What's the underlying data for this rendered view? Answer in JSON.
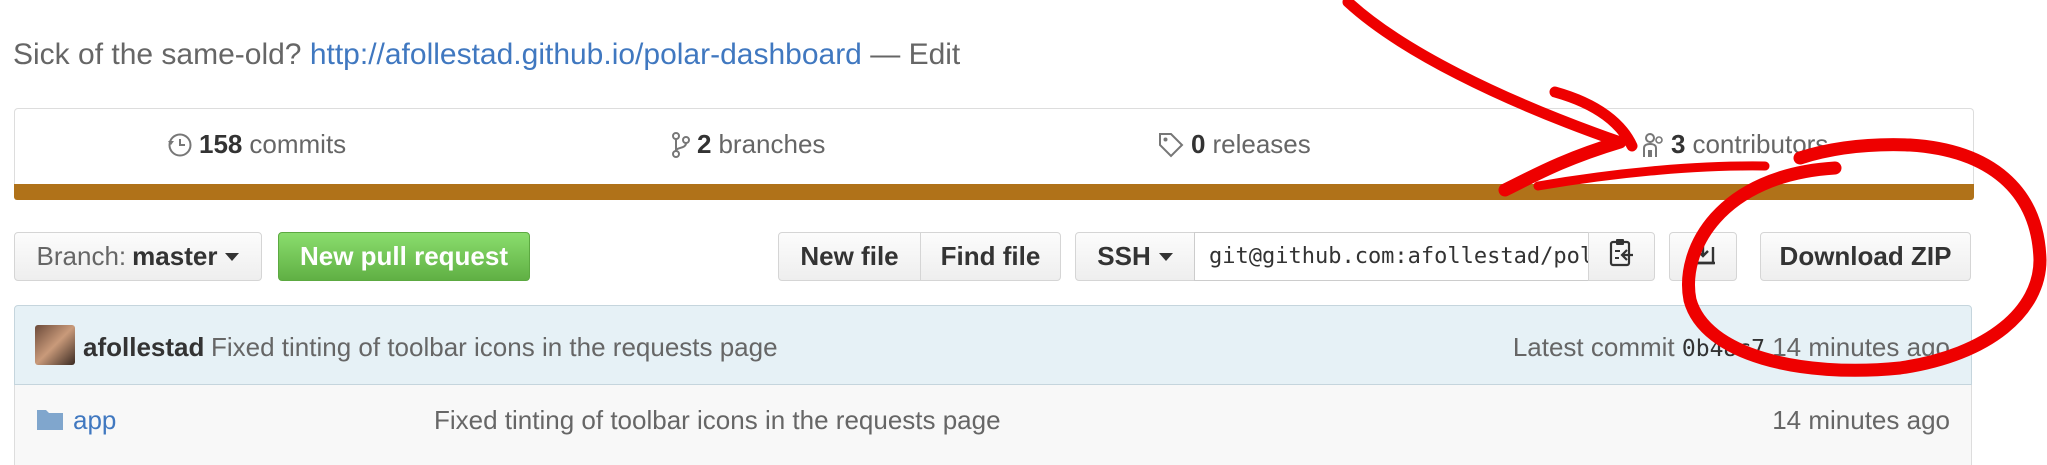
{
  "description": {
    "prefix": "Sick of the same-old?",
    "url": "http://afollestad.github.io/polar-dashboard",
    "separator": "—",
    "edit": "Edit"
  },
  "summary": {
    "commits": {
      "count": "158",
      "label": "commits",
      "icon": "history-icon"
    },
    "branches": {
      "count": "2",
      "label": "branches",
      "icon": "branch-icon"
    },
    "releases": {
      "count": "0",
      "label": "releases",
      "icon": "tag-icon"
    },
    "contributors": {
      "count": "3",
      "label": "contributors",
      "icon": "organization-icon"
    }
  },
  "language_bar": {
    "color": "#b07219",
    "percent": 100
  },
  "toolbar": {
    "branch_prefix": "Branch:",
    "branch_name": "master",
    "new_pull_request": "New pull request",
    "new_file": "New file",
    "find_file": "Find file",
    "protocol": "SSH",
    "clone_url": "git@github.com:afollestad/polar-dashboard.git",
    "clipboard_icon": "clippy-icon",
    "desktop_icon": "desktop-download-icon",
    "download_zip": "Download ZIP"
  },
  "latest_commit": {
    "author": "afollestad",
    "message": "Fixed tinting of toolbar icons in the requests page",
    "label": "Latest commit",
    "sha": "0b48c7",
    "age": "14 minutes ago"
  },
  "files": [
    {
      "name": "app",
      "type": "folder",
      "message": "Fixed tinting of toolbar icons in the requests page",
      "age": "14 minutes ago"
    }
  ],
  "colors": {
    "link": "#4078c0",
    "green_button": "#60b044",
    "commit_bar_bg": "#e6f1f6",
    "annotation": "#ee0000"
  }
}
